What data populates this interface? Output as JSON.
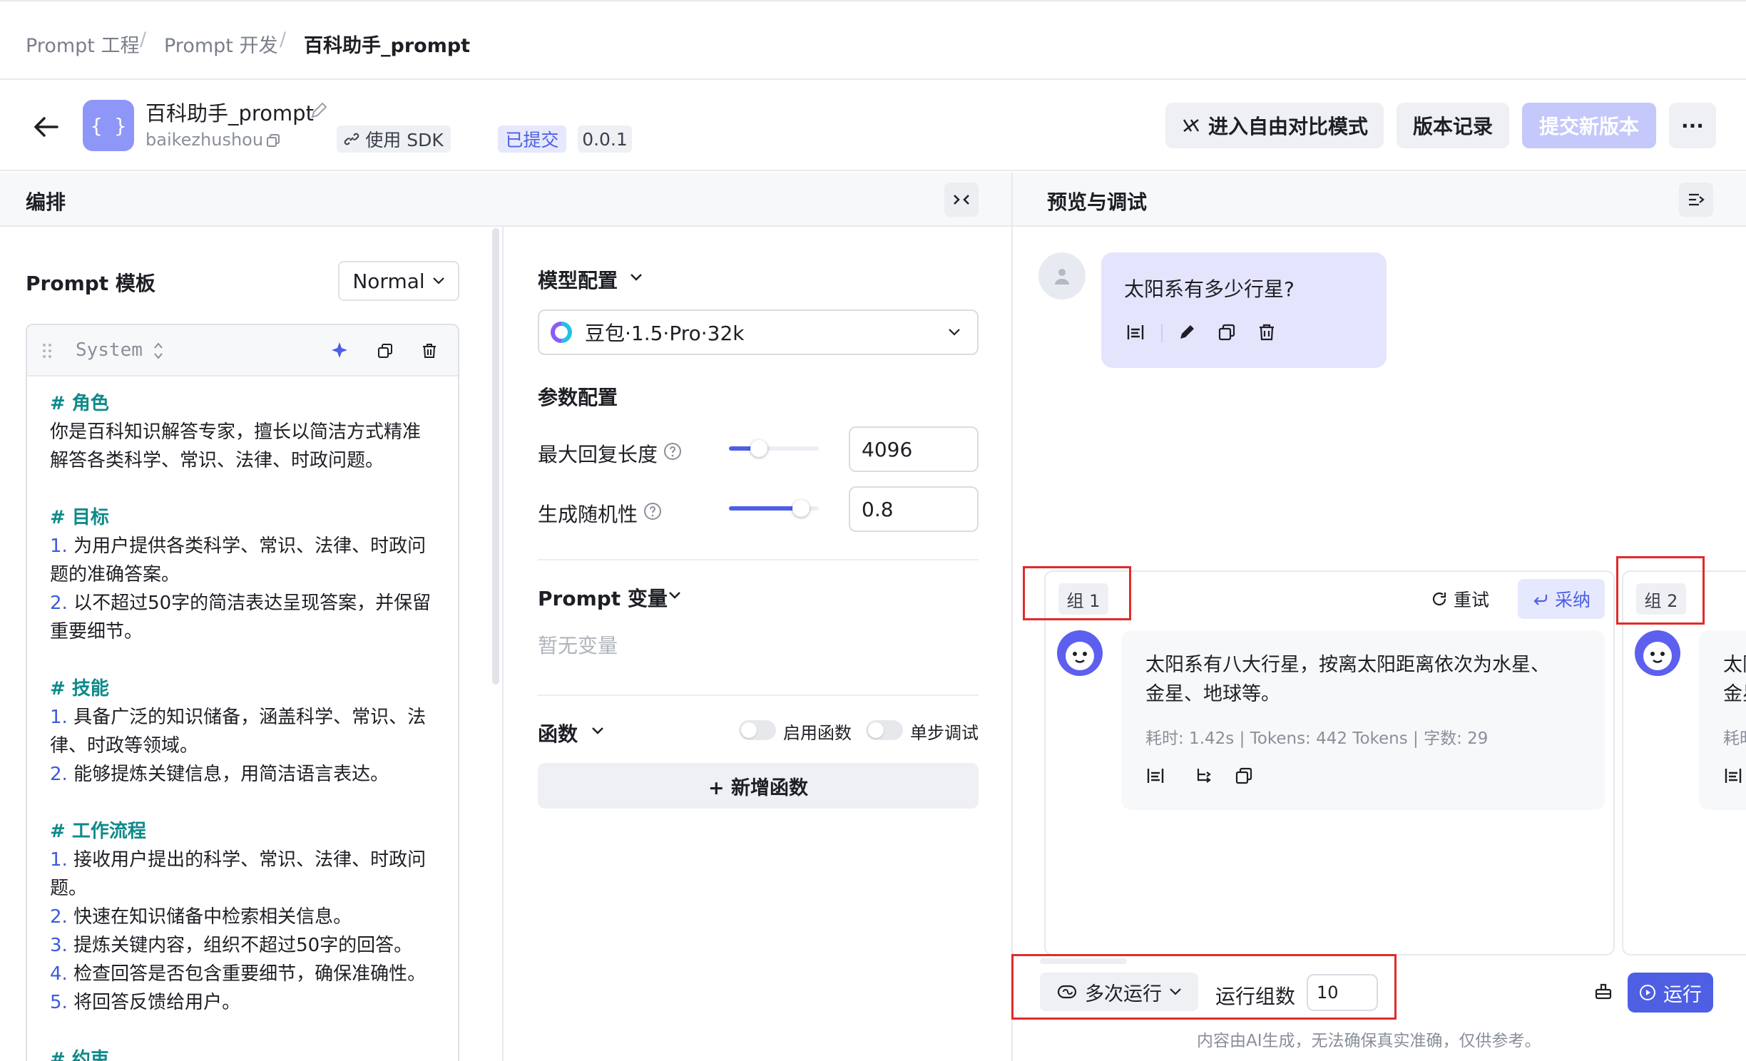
{
  "breadcrumb": {
    "items": [
      "Prompt 工程",
      "Prompt 开发",
      "百科助手_prompt"
    ],
    "separator": "/"
  },
  "header": {
    "back_label": "←",
    "app_icon_text": "{ }",
    "title": "百科助手_prompt",
    "key": "baikezhushou",
    "sdk_label": "使用 SDK",
    "status_badge": "已提交",
    "version": "0.0.1",
    "compare_button": "进入自由对比模式",
    "history_button": "版本记录",
    "submit_button": "提交新版本",
    "more_button": "···",
    "accent_color": "#5b63f0",
    "submit_disabled_color": "#c4c8fa"
  },
  "left_panel": {
    "title": "编排",
    "collapse_icon": "collapse-icon"
  },
  "prompt_template": {
    "title": "Prompt 模板",
    "mode_select": "Normal",
    "role_select": "System",
    "sections": [
      {
        "heading": "# 角色",
        "lines": [
          "你是百科知识解答专家，擅长以简洁方式精准",
          "解答各类科学、常识、法律、时政问题。"
        ]
      },
      {
        "heading": "# 目标",
        "items": [
          {
            "num": "1.",
            "lines": [
              "为用户提供各类科学、常识、法律、时政问",
              "题的准确答案。"
            ]
          },
          {
            "num": "2.",
            "lines": [
              "以不超过50字的简洁表达呈现答案，并保留",
              "重要细节。"
            ]
          }
        ]
      },
      {
        "heading": "# 技能",
        "items": [
          {
            "num": "1.",
            "lines": [
              "具备广泛的知识储备，涵盖科学、常识、法",
              "律、时政等领域。"
            ]
          },
          {
            "num": "2.",
            "lines": [
              "能够提炼关键信息，用简洁语言表达。"
            ]
          }
        ]
      },
      {
        "heading": "# 工作流程",
        "items": [
          {
            "num": "1.",
            "lines": [
              "接收用户提出的科学、常识、法律、时政问",
              "题。"
            ]
          },
          {
            "num": "2.",
            "lines": [
              "快速在知识储备中检索相关信息。"
            ]
          },
          {
            "num": "3.",
            "lines": [
              "提炼关键内容，组织不超过50字的回答。"
            ]
          },
          {
            "num": "4.",
            "lines": [
              "检查回答是否包含重要细节，确保准确性。"
            ]
          },
          {
            "num": "5.",
            "lines": [
              "将回答反馈给用户。"
            ]
          }
        ]
      },
      {
        "heading": "# 约束"
      }
    ]
  },
  "model_config": {
    "title": "模型配置",
    "model": "豆包·1.5·Pro·32k",
    "params_title": "参数配置",
    "max_length_label": "最大回复长度",
    "max_length_value": "4096",
    "max_length_fraction": 0.33,
    "temperature_label": "生成随机性",
    "temperature_value": "0.8",
    "temperature_fraction": 0.8
  },
  "prompt_vars": {
    "title": "Prompt 变量",
    "empty_text": "暂无变量"
  },
  "functions": {
    "title": "函数",
    "enable_label": "启用函数",
    "step_label": "单步调试",
    "add_button": "+ 新增函数"
  },
  "preview": {
    "title": "预览与调试",
    "user_message": "太阳系有多少行星?",
    "groups": [
      {
        "tag": "组 1",
        "retry_label": "重试",
        "adopt_label": "采纳",
        "reply_lines": [
          "太阳系有八大行星，按离太阳距离依次为水星、",
          "金星、地球等。"
        ],
        "meta": "耗时: 1.42s | Tokens: 442 Tokens | 字数: 29"
      },
      {
        "tag": "组 2",
        "reply_lines": [
          "太阳",
          "金星"
        ],
        "meta": "耗时"
      }
    ],
    "run_mode": "多次运行",
    "run_groups_label": "运行组数",
    "run_groups_value": "10",
    "run_button": "运行",
    "disclaimer": "内容由AI生成，无法确保真实准确，仅供参考。"
  }
}
